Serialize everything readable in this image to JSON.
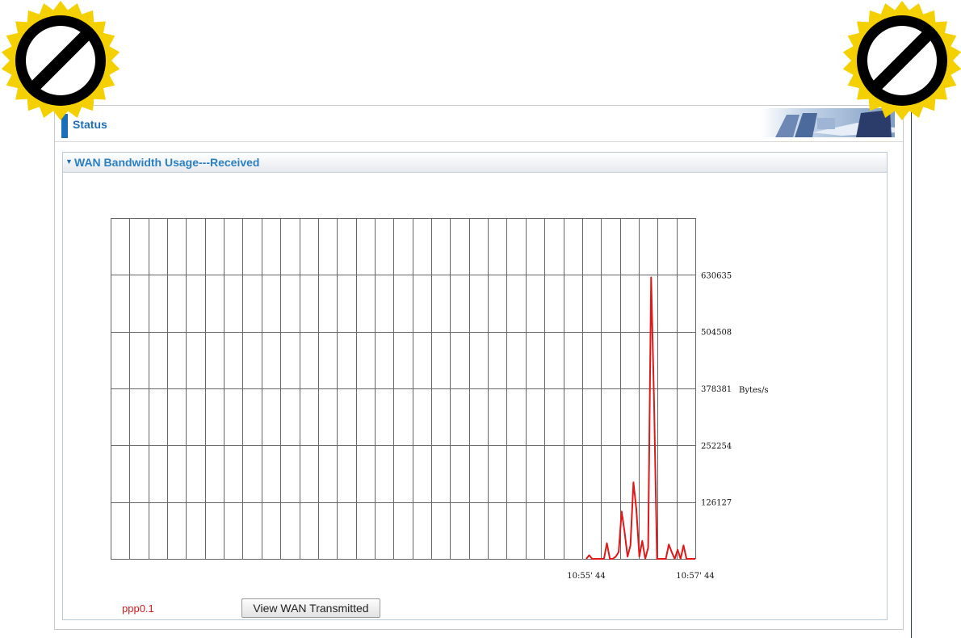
{
  "header": {
    "title": "Status"
  },
  "panel": {
    "title": "WAN Bandwidth Usage---Received",
    "arrow": "▼"
  },
  "interface": {
    "name": "ppp0.1"
  },
  "actions": {
    "view_transmitted_label": "View WAN Transmitted"
  },
  "badges": {
    "icon": "prohibited-sign-icon",
    "fill": "#f5d000",
    "ring": "#000000"
  },
  "colors": {
    "accent": "#1f6eb4",
    "series": "#e01818",
    "grid": "#666666",
    "interface": "#d01b1b"
  },
  "chart_data": {
    "type": "line",
    "title": "",
    "xlabel": "",
    "ylabel": "Bytes/s",
    "ylim": [
      0,
      756762
    ],
    "yticks": [
      126127,
      252254,
      378381,
      504508,
      630635
    ],
    "ytick_labels": [
      "126127",
      "252254",
      "378381",
      "504508",
      "630635"
    ],
    "xtick_labels": [
      "10:55' 44",
      "10:57' 44"
    ],
    "grid": true,
    "series": [
      {
        "values": [
          [
            0,
            0
          ],
          [
            1,
            8000
          ],
          [
            2,
            0
          ],
          [
            3,
            0
          ],
          [
            4,
            0
          ],
          [
            5,
            0
          ],
          [
            6,
            0
          ],
          [
            7,
            35000
          ],
          [
            8,
            0
          ],
          [
            9,
            0
          ],
          [
            10,
            5000
          ],
          [
            11,
            15000
          ],
          [
            12,
            105000
          ],
          [
            13,
            60000
          ],
          [
            14,
            5000
          ],
          [
            15,
            30000
          ],
          [
            16,
            170000
          ],
          [
            17,
            110000
          ],
          [
            18,
            5000
          ],
          [
            19,
            40000
          ],
          [
            20,
            0
          ],
          [
            21,
            25000
          ],
          [
            22,
            625000
          ],
          [
            23,
            350000
          ],
          [
            24,
            0
          ],
          [
            25,
            0
          ],
          [
            26,
            0
          ],
          [
            27,
            0
          ],
          [
            28,
            32000
          ],
          [
            29,
            15000
          ],
          [
            30,
            0
          ],
          [
            31,
            20000
          ],
          [
            32,
            0
          ],
          [
            33,
            30000
          ],
          [
            34,
            0
          ],
          [
            35,
            0
          ],
          [
            36,
            0
          ],
          [
            37,
            0
          ]
        ]
      }
    ]
  }
}
